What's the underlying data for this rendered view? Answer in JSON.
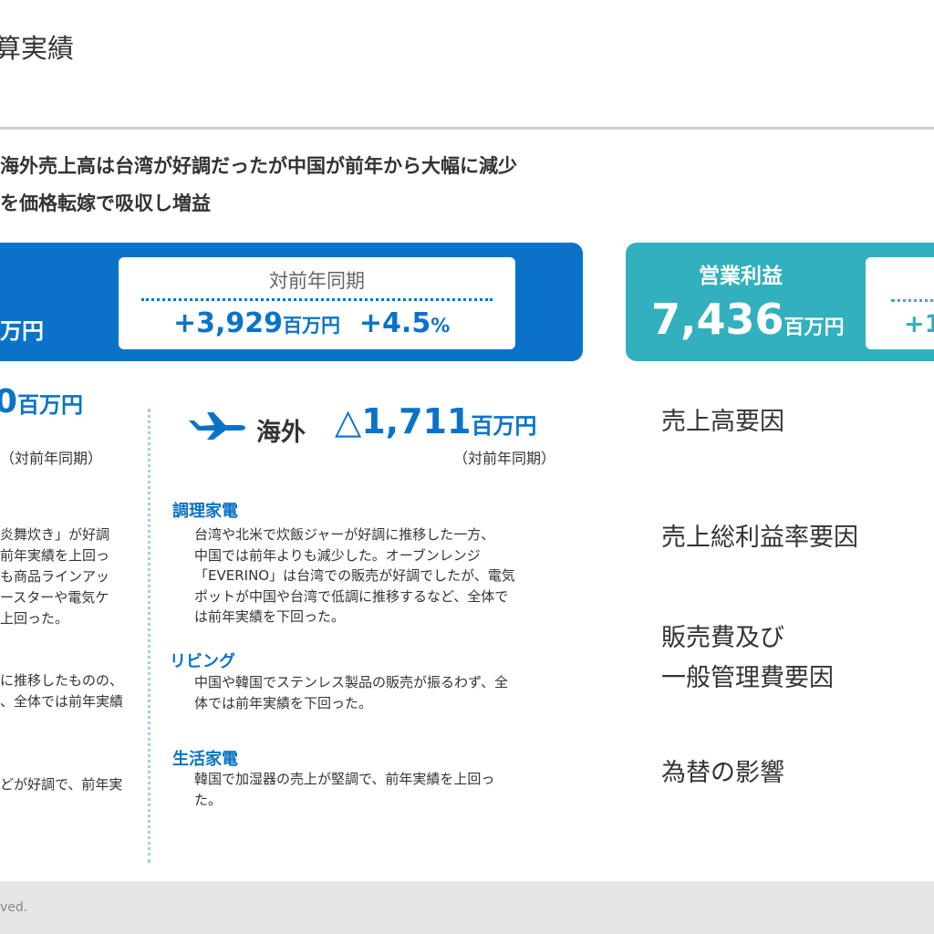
{
  "page": {
    "title": "算実績",
    "headline1": "海外売上高は台湾が好調だったが中国が前年から大幅に減少",
    "headline2": "を価格転嫁で吸収し増益"
  },
  "sales_panel": {
    "unit": "万円",
    "yoy_label": "対前年同期",
    "yoy_amount": "+3,929",
    "yoy_unit": "百万円",
    "yoy_pct": "+4.5",
    "pct_sign": "%"
  },
  "op_panel": {
    "label": "営業利益",
    "value": "7,436",
    "unit": "百万円",
    "yoy_partial": "+1"
  },
  "domestic": {
    "value_partial": "0",
    "unit": "百万円",
    "sub": "（対前年同期）",
    "lines1": [
      "炎舞炊き」が好調",
      "前年実績を上回っ",
      "も商品ラインアッ",
      "ースターや電気ケ",
      "上回った。"
    ],
    "lines2": [
      "に推移したものの、",
      "、全体では前年実績"
    ],
    "lines3": [
      "どが好調で、前年実"
    ]
  },
  "overseas": {
    "label": "海外",
    "value": "△1,711",
    "unit": "百万円",
    "sub": "（対前年同期）",
    "icon": "airplane-icon",
    "categories": [
      {
        "name": "調理家電",
        "text": "台湾や北米で炊飯ジャーが好調に推移した一方、\n中国では前年よりも減少した。オーブンレンジ\n「EVERINO」は台湾での販売が好調でしたが、電気\nポットが中国や台湾で低調に推移するなど、全体で\nは前年実績を下回った。"
      },
      {
        "name": "リビング",
        "text": "中国や韓国でステンレス製品の販売が振るわず、全\n体では前年実績を下回った。"
      },
      {
        "name": "生活家電",
        "text": "韓国で加湿器の売上が堅調で、前年実績を上回っ\nた。"
      }
    ]
  },
  "factors": [
    "売上高要因",
    "売上総利益率要因",
    "販売費及び\n一般管理費要因",
    "為替の影響"
  ],
  "footer": {
    "text": "ved."
  },
  "colors": {
    "blue": "#0a73c9",
    "teal": "#33b0bd"
  }
}
